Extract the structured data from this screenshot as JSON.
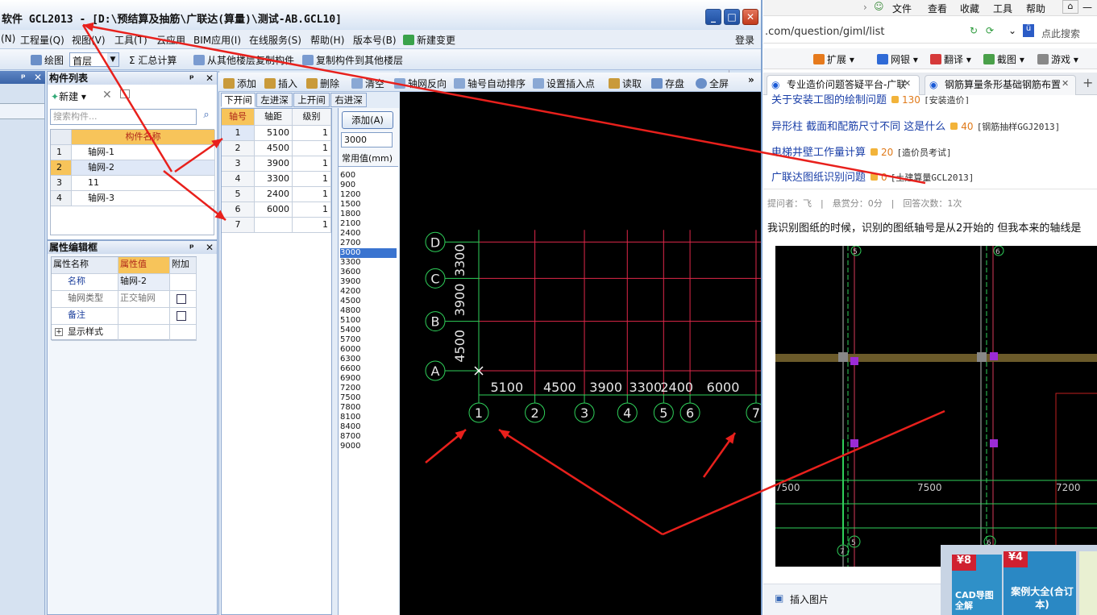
{
  "app": {
    "title": "软件 GCL2013 - [D:\\预结算及抽筋\\广联达(算量)\\测试-AB.GCL10]",
    "menu": [
      "(N)",
      "工程量(Q)",
      "视图(V)",
      "工具(T)",
      "云应用",
      "BIM应用(I)",
      "在线服务(S)",
      "帮助(H)",
      "版本号(B)",
      "新建变更"
    ],
    "login": "登录",
    "toolbar1": {
      "draw": "绘图",
      "floor": "首层",
      "sum": "汇总计算",
      "copy_from": "从其他楼层复制构件",
      "copy_to": "复制构件到其他楼层"
    },
    "toolbar2": [
      "添加",
      "插入",
      "删除",
      "清空",
      "轴网反向",
      "轴号自动排序",
      "设置插入点",
      "读取",
      "存盘",
      "全屏"
    ],
    "more": "»"
  },
  "component_list": {
    "title": "构件列表",
    "new_label": "新建",
    "search_placeholder": "搜索构件...",
    "column": "构件名称",
    "rows": [
      {
        "no": "1",
        "name": "轴网-1"
      },
      {
        "no": "2",
        "name": "轴网-2"
      },
      {
        "no": "3",
        "name": "11"
      },
      {
        "no": "4",
        "name": "轴网-3"
      }
    ]
  },
  "property_box": {
    "title": "属性编辑框",
    "headers": [
      "属性名称",
      "属性值",
      "附加"
    ],
    "rows": [
      {
        "name": "名称",
        "value": "轴网-2"
      },
      {
        "name": "轴网类型",
        "value": "正交轴网"
      },
      {
        "name": "备注",
        "value": ""
      },
      {
        "name": "显示样式",
        "value": ""
      }
    ]
  },
  "axis_tabs": [
    "下开间",
    "左进深",
    "上开间",
    "右进深"
  ],
  "axis_table": {
    "headers": [
      "轴号",
      "轴距",
      "级别"
    ],
    "rows": [
      {
        "no": "1",
        "dist": "5100",
        "level": "1"
      },
      {
        "no": "2",
        "dist": "4500",
        "level": "1"
      },
      {
        "no": "3",
        "dist": "3900",
        "level": "1"
      },
      {
        "no": "4",
        "dist": "3300",
        "level": "1"
      },
      {
        "no": "5",
        "dist": "2400",
        "level": "1"
      },
      {
        "no": "6",
        "dist": "6000",
        "level": "1"
      },
      {
        "no": "7",
        "dist": "",
        "level": "1"
      }
    ]
  },
  "add_button": "添加(A)",
  "input_value": "3000",
  "common_label": "常用值(mm)",
  "common_values": [
    "600",
    "900",
    "1200",
    "1500",
    "1800",
    "2100",
    "2400",
    "2700",
    "3000",
    "3300",
    "3600",
    "3900",
    "4200",
    "4500",
    "4800",
    "5100",
    "5400",
    "5700",
    "6000",
    "6300",
    "6600",
    "6900",
    "7200",
    "7500",
    "7800",
    "8100",
    "8400",
    "8700",
    "9000"
  ],
  "common_selected": "3000",
  "cad": {
    "row_labels": [
      "D",
      "C",
      "B",
      "A"
    ],
    "row_dims": [
      "3300",
      "3900",
      "4500"
    ],
    "col_labels": [
      "1",
      "2",
      "3",
      "4",
      "5",
      "6",
      "7"
    ],
    "col_dims": [
      "5100",
      "4500",
      "3900",
      "3300",
      "2400",
      "6000"
    ]
  },
  "browser": {
    "top_menu": [
      "文件",
      "查看",
      "收藏",
      "工具",
      "帮助"
    ],
    "address": ".com/question/giml/list",
    "search_hint": "点此搜索",
    "toolbar": [
      "扩展",
      "网银",
      "翻译",
      "截图",
      "游戏"
    ],
    "tabs": [
      "专业造价问题答疑平台-广联",
      "钢筋算量条形基础钢筋布置"
    ],
    "questions": [
      {
        "title": "关于安装工图的绘制问题",
        "reward": "130",
        "tag": "[安装造价]"
      },
      {
        "title": "异形柱 截面和配筋尺寸不同 这是什么",
        "reward": "40",
        "tag": "[钢筋抽样GGJ2013]"
      },
      {
        "title": "电梯井壁工作量计算",
        "reward": "20",
        "tag": "[造价员考试]"
      },
      {
        "title": "广联达图纸识别问题",
        "reward": "0",
        "tag": "[土建算量GCL2013]"
      }
    ],
    "meta": "提问者：飞　|　悬赏分：0分　|　回答次数：1次",
    "body": "我识别图纸的时候，识别的图纸轴号是从2开始的 但我本来的轴线是",
    "screenshot_dims": [
      "7500",
      "7500",
      "7200"
    ],
    "screenshot_labels": [
      "5",
      "6",
      "5",
      "6",
      "7"
    ],
    "insert_image": "插入图片",
    "ads": [
      {
        "badge": "¥8",
        "text": "CAD导图全解"
      },
      {
        "badge": "¥4",
        "text": "案例大全(合订本)"
      }
    ]
  },
  "colors": {
    "accent": "#3b64a8",
    "grid": "#e0284a",
    "annotation": "#e8201c",
    "cad_green": "#2fd05a"
  }
}
